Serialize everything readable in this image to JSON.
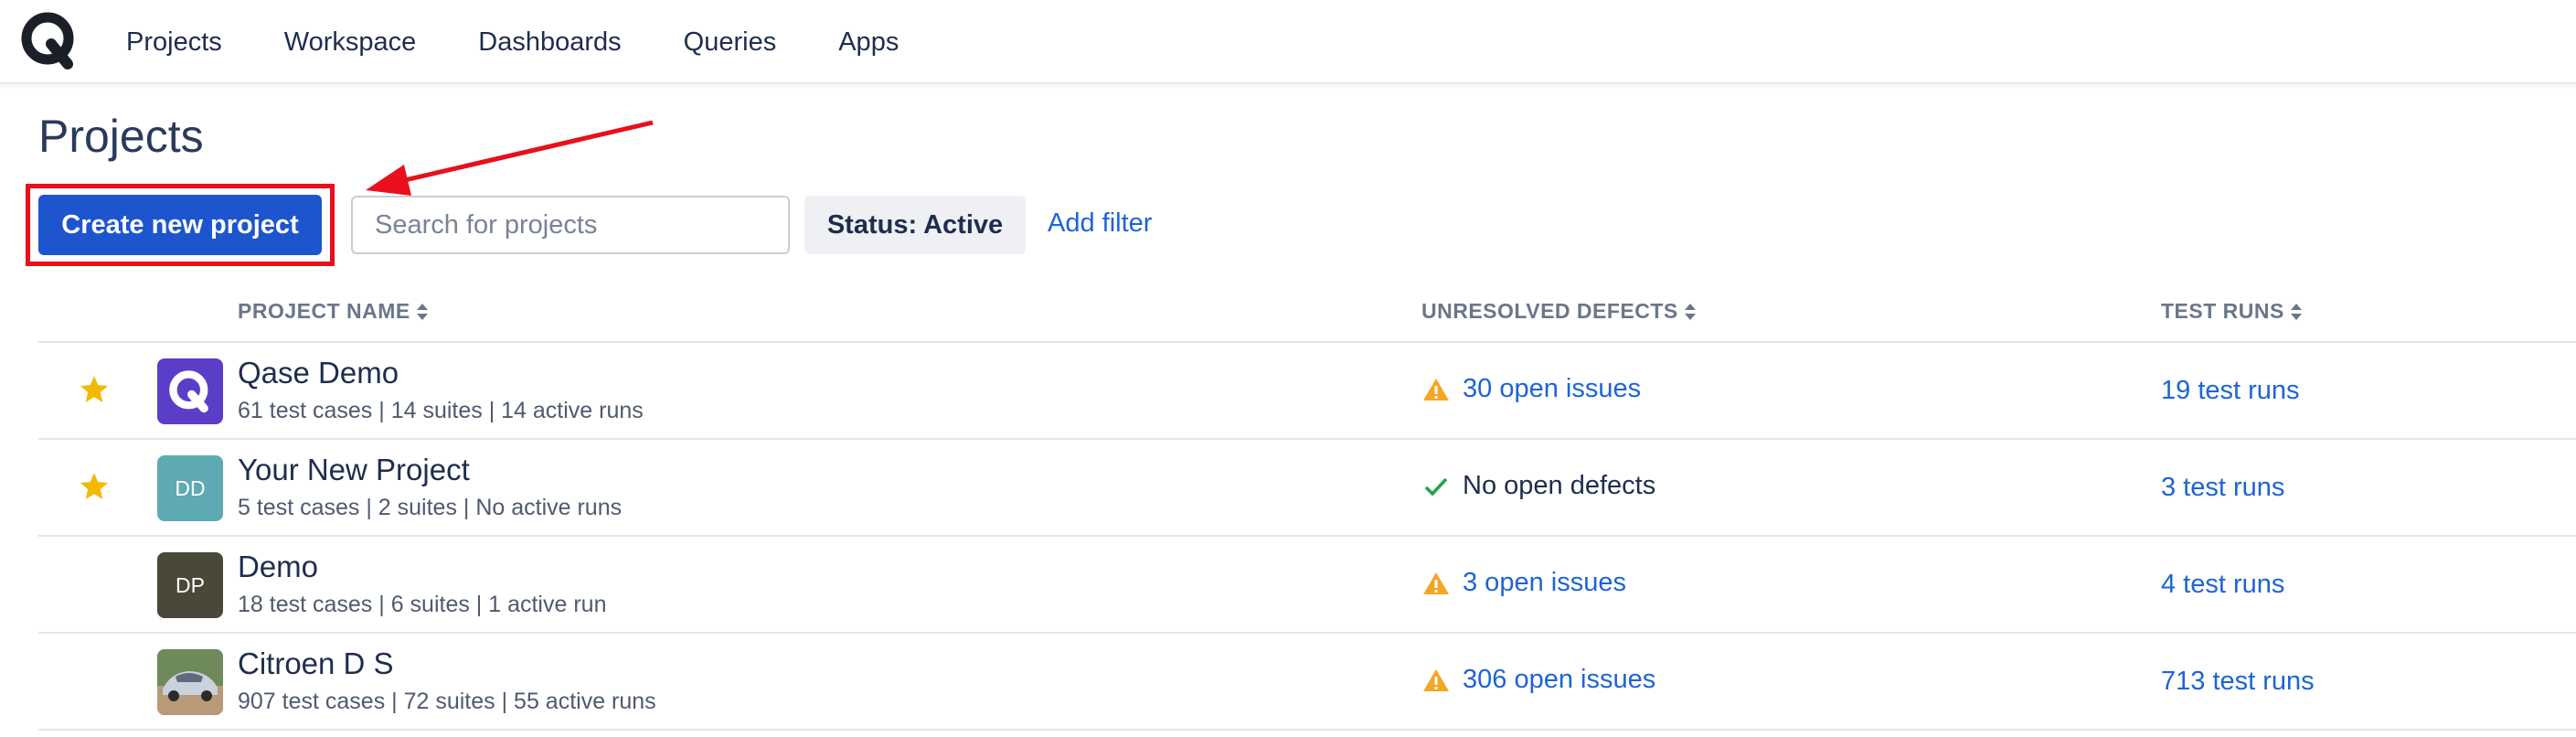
{
  "nav": {
    "logo_icon": "qase-logo-icon",
    "items": [
      "Projects",
      "Workspace",
      "Dashboards",
      "Queries",
      "Apps"
    ]
  },
  "page": {
    "title": "Projects"
  },
  "toolbar": {
    "create_label": "Create new project",
    "search_placeholder": "Search for projects",
    "search_value": "",
    "status_filter": "Status: Active",
    "add_filter_label": "Add filter",
    "accent_color": "#1d55cf",
    "annotation_color": "#e8101a"
  },
  "table": {
    "columns": {
      "name": "PROJECT NAME",
      "defects": "UNRESOLVED DEFECTS",
      "runs": "TEST RUNS"
    },
    "rows": [
      {
        "starred": true,
        "avatar": {
          "type": "logo",
          "icon": "qase-logo-icon",
          "bg": "#5b3ec8"
        },
        "name": "Qase Demo",
        "meta": "61 test cases | 14 suites | 14 active runs",
        "defects": {
          "status": "warning",
          "text": "30 open issues"
        },
        "runs": "19 test runs"
      },
      {
        "starred": true,
        "avatar": {
          "type": "initials",
          "text": "DD",
          "bg": "#5eaab3"
        },
        "name": "Your New Project",
        "meta": "5 test cases | 2 suites | No active runs",
        "defects": {
          "status": "ok",
          "text": "No open defects"
        },
        "runs": "3 test runs"
      },
      {
        "starred": false,
        "avatar": {
          "type": "initials",
          "text": "DP",
          "bg": "#4a4838"
        },
        "name": "Demo",
        "meta": "18 test cases | 6 suites | 1 active run",
        "defects": {
          "status": "warning",
          "text": "3 open issues"
        },
        "runs": "4 test runs"
      },
      {
        "starred": false,
        "avatar": {
          "type": "photo",
          "icon": "car-photo-icon",
          "bg": "#8f7a5c"
        },
        "name": "Citroen D S",
        "meta": "907 test cases | 72 suites | 55 active runs",
        "defects": {
          "status": "warning",
          "text": "306 open issues"
        },
        "runs": "713 test runs"
      }
    ]
  }
}
